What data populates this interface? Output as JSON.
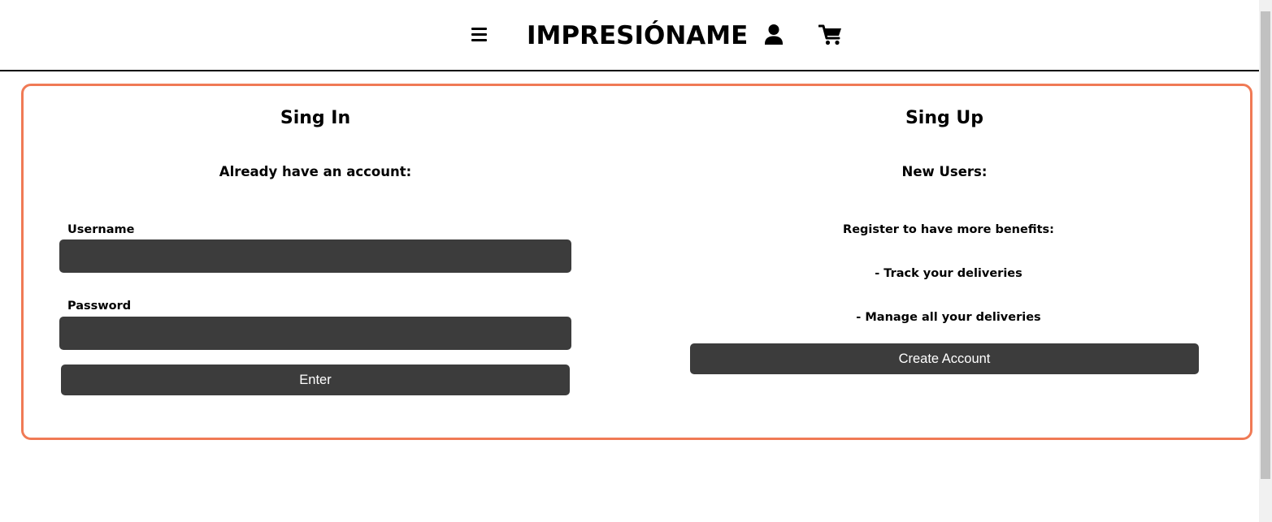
{
  "header": {
    "brand": "IMPRESIÓNAME",
    "icons": {
      "menu": "hamburger-menu-icon",
      "user": "user-icon",
      "cart": "shopping-cart-icon"
    }
  },
  "signin": {
    "title": "Sing In",
    "subtitle": "Already have an account:",
    "username_label": "Username",
    "username_value": "",
    "password_label": "Password",
    "password_value": "",
    "submit_label": "Enter"
  },
  "signup": {
    "title": "Sing Up",
    "subtitle": "New Users:",
    "intro": "Register to have more benefits:",
    "benefits": [
      "- Track your deliveries",
      "- Manage all your deliveries"
    ],
    "submit_label": "Create Account"
  },
  "colors": {
    "accent_border": "#f07a55",
    "dark_control": "#3c3c3c"
  }
}
